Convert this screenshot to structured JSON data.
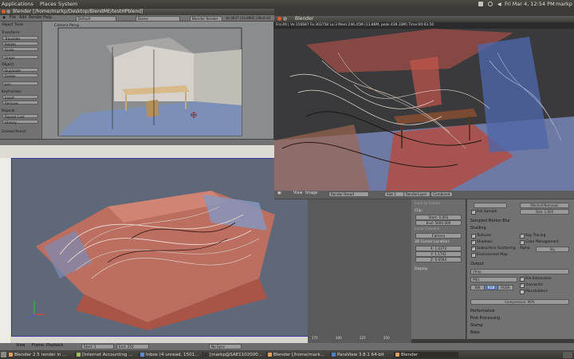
{
  "top_panel": {
    "menus": [
      "Applications",
      "Places",
      "System"
    ],
    "clock": "Fri Mar 4, 12:54 PM",
    "user": "markp"
  },
  "blender": {
    "window_title": "Blender [/home/markp/Desktop/BlendME/testHPblend]",
    "menu": [
      "File",
      "Add",
      "Render",
      "Help"
    ],
    "screen": "Default",
    "scene": "Scene",
    "engine": "Blender Render",
    "stats": "Ve:3637 | Fa:3602 | Ob:0-33"
  },
  "tool_panel": {
    "title": "Object Tools",
    "sections": [
      {
        "heading": "Transform:",
        "buttons": [
          "Translate",
          "Rotate",
          "Scale",
          "Origin"
        ]
      },
      {
        "heading": "Object:",
        "buttons": [
          "Duplicate",
          "Delete",
          "Join"
        ]
      },
      {
        "heading": "Keyframes:",
        "buttons": [
          "Insert",
          "Remove"
        ]
      },
      {
        "heading": "Repeat:",
        "buttons": [
          "Repeat Last",
          "History..."
        ]
      }
    ],
    "footer": "Grease Pencil"
  },
  "camera_view": {
    "label": "Camera Persp"
  },
  "render_window": {
    "title": "Blender",
    "info": "Fra:49 | Ve:156687 Fa:303758 La:3 Mem:246.45M (13.86M, peak 439.33M) Time:00:03.50",
    "toolbar": [
      "View",
      "Image"
    ],
    "image": "Render Result",
    "slot": "Slot 1",
    "layer": "RenderLayer",
    "pass": "Combined"
  },
  "npanel": {
    "lock_camera": "Lock to Cursor",
    "clip_heading": "Clip:",
    "clip_start": "Start: 0.001",
    "clip_end": "End: 5000.000",
    "local_camera": "Local Camera:",
    "camera": "Camera",
    "cursor_heading": "3D Cursor Location:",
    "cursor_x": "X: 1.0374",
    "cursor_y": "Y: 1.1742",
    "cursor_z": "Z: 0.6564",
    "display": "Display"
  },
  "properties": {
    "fps": "Mitchell-Netravali",
    "size": "Size: 1.000",
    "full_sample": "Full Sample",
    "motion_blur": "Sampled Motion Blur",
    "shading_heading": "Shading",
    "shading": [
      {
        "label": "Textures",
        "on": true
      },
      {
        "label": "Shadows",
        "on": true
      },
      {
        "label": "Subsurface Scattering",
        "on": true
      },
      {
        "label": "Environment Map",
        "on": true
      },
      {
        "label": "Ray Tracing",
        "on": true
      },
      {
        "label": "Color Management",
        "on": true
      }
    ],
    "alpha_label": "Alpha:",
    "alpha_value": "Sky",
    "output_heading": "Output",
    "output_path": "//tmp",
    "format": "PNG",
    "file_ext": "File Extensions",
    "overwrite": "Overwrite",
    "placeholders": "Placeholders",
    "color_modes": [
      "BW",
      "RGB",
      "RGBA"
    ],
    "compression": "Compression: 90%",
    "panels": [
      "Performance",
      "Post Processing",
      "Stamp",
      "Bake"
    ]
  },
  "timeline": {
    "numbers": [
      "175",
      "200",
      "225",
      "250"
    ],
    "bottom": [
      "View",
      "Frame",
      "Playback",
      "Start: 1",
      "End: 250",
      "No Sync"
    ]
  },
  "taskbar": [
    {
      "label": "Blender 2.5 render in ..."
    },
    {
      "label": "[Internet Accounting ..."
    },
    {
      "label": "Inbox (4 unread, 1501..."
    },
    {
      "label": "[markp@SAE1102000..."
    },
    {
      "label": "Blender [/home/mark..."
    },
    {
      "label": "ParaView 3.8.1 64-bit"
    },
    {
      "label": "Blender"
    }
  ]
}
